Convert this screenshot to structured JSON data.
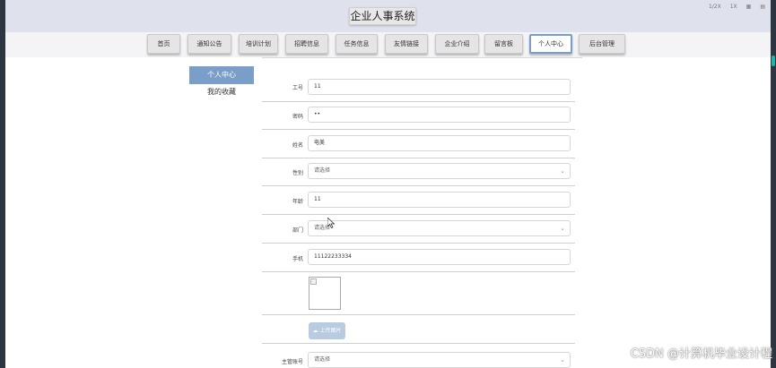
{
  "header": {
    "site_title": "企业人事系统",
    "top_right": [
      "1/2X",
      "1X",
      "▦",
      "▤"
    ]
  },
  "nav": {
    "items": [
      "首页",
      "通知公告",
      "培训计划",
      "招聘信息",
      "任务信息",
      "友情链接",
      "企业介绍",
      "留言板",
      "个人中心",
      "后台管理"
    ],
    "active": "个人中心"
  },
  "sidebar": {
    "items": [
      "个人中心",
      "我的收藏"
    ]
  },
  "form": {
    "gonghao": {
      "label": "工号",
      "value": "11"
    },
    "mima": {
      "label": "密码",
      "value": "••"
    },
    "xingming": {
      "label": "姓名",
      "value": "电美"
    },
    "xingbie": {
      "label": "性别",
      "placeholder": "请选择"
    },
    "nianling": {
      "label": "年龄",
      "value": "11"
    },
    "bumen": {
      "label": "部门",
      "placeholder": "请选择"
    },
    "shouji": {
      "label": "手机",
      "value": "11122233334"
    },
    "upload_label": "上传图片",
    "zhuguan": {
      "label": "主管账号",
      "placeholder": "请选择"
    }
  },
  "watermark": "CSDN @计算机毕业设计程"
}
